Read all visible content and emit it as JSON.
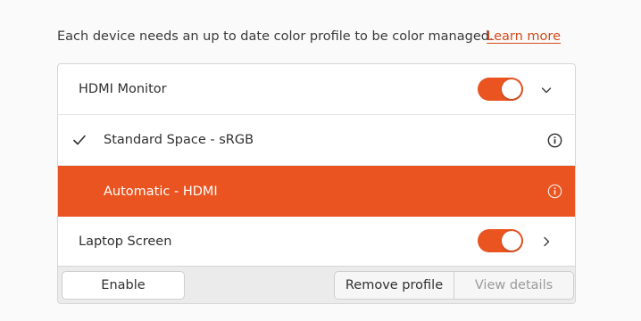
{
  "intro": {
    "text": "Each device needs an up to date color profile to be color managed.",
    "link_label": "Learn more"
  },
  "devices": [
    {
      "label": "HDMI Monitor",
      "enabled": true,
      "expanded": true,
      "profiles": [
        {
          "label": "Standard Space - sRGB",
          "selected": true,
          "highlighted": false
        },
        {
          "label": "Automatic - HDMI",
          "selected": false,
          "highlighted": true
        }
      ]
    },
    {
      "label": "Laptop Screen",
      "enabled": true,
      "expanded": false
    }
  ],
  "actions": {
    "enable_label": "Enable",
    "remove_label": "Remove profile",
    "view_label": "View details",
    "view_disabled": true
  },
  "colors": {
    "accent": "#e95420",
    "link": "#d44a1c",
    "background": "#fafafa"
  },
  "icons": {
    "check": "check-icon",
    "info": "info-icon",
    "chevron_down": "chevron-down-icon",
    "chevron_right": "chevron-right-icon"
  }
}
